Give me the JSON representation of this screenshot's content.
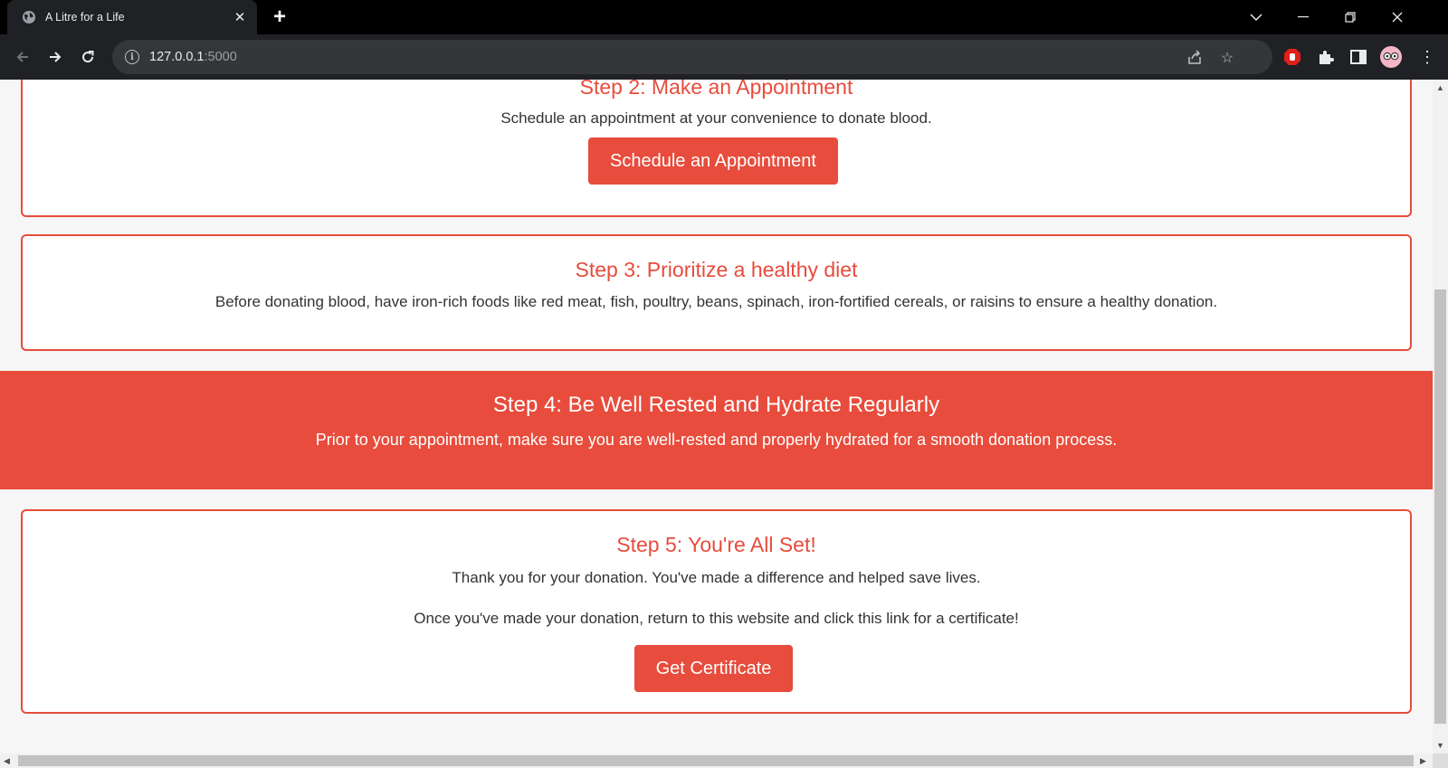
{
  "browser": {
    "tab_title": "A Litre for a Life",
    "url_host": "127.0.0.1",
    "url_port": ":5000"
  },
  "page": {
    "step2": {
      "title": "Step 2: Make an Appointment",
      "text": "Schedule an appointment at your convenience to donate blood.",
      "button": "Schedule an Appointment"
    },
    "step3": {
      "title": "Step 3: Prioritize a healthy diet",
      "text": "Before donating blood, have iron-rich foods like red meat, fish, poultry, beans, spinach, iron-fortified cereals, or raisins to ensure a healthy donation."
    },
    "step4": {
      "title": "Step 4: Be Well Rested and Hydrate Regularly",
      "text": "Prior to your appointment, make sure you are well-rested and properly hydrated for a smooth donation process."
    },
    "step5": {
      "title": "Step 5: You're All Set!",
      "text1": "Thank you for your donation. You've made a difference and helped save lives.",
      "text2": "Once you've made your donation, return to this website and click this link for a certificate!",
      "button": "Get Certificate"
    }
  },
  "colors": {
    "accent": "#e74c3c",
    "chrome_dark": "#202124"
  }
}
